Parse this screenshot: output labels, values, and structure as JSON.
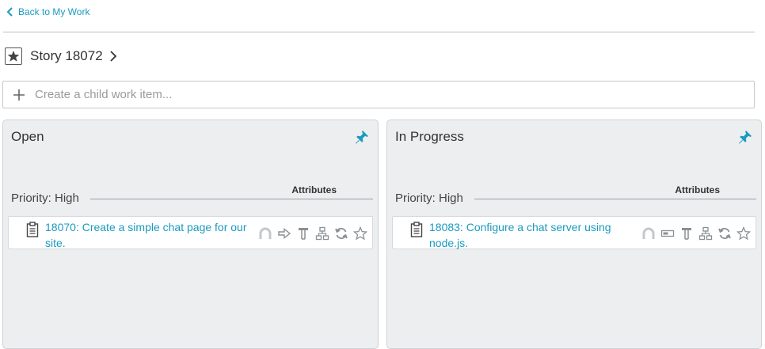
{
  "nav": {
    "back_label": "Back to My Work"
  },
  "story": {
    "title": "Story 18072"
  },
  "create": {
    "placeholder": "Create a child work item..."
  },
  "columns": [
    {
      "title": "Open",
      "attributes_label": "Attributes",
      "group_label": "Priority: High",
      "card": {
        "title": "18070: Create a simple chat page for our site.",
        "actions": [
          "avatar-icon",
          "arrow-right-icon",
          "size-icon",
          "hierarchy-icon",
          "refresh-icon",
          "star-icon"
        ]
      }
    },
    {
      "title": "In Progress",
      "attributes_label": "Attributes",
      "group_label": "Priority: High",
      "card": {
        "title": "18083: Configure a chat server using node.js.",
        "actions": [
          "avatar-icon",
          "progress-bar-icon",
          "size-icon",
          "hierarchy-icon",
          "refresh-icon",
          "star-icon"
        ]
      }
    }
  ],
  "colors": {
    "accent": "#1a9bbf",
    "column_bg": "#eceef0",
    "icon_gray": "#8a8f93"
  }
}
